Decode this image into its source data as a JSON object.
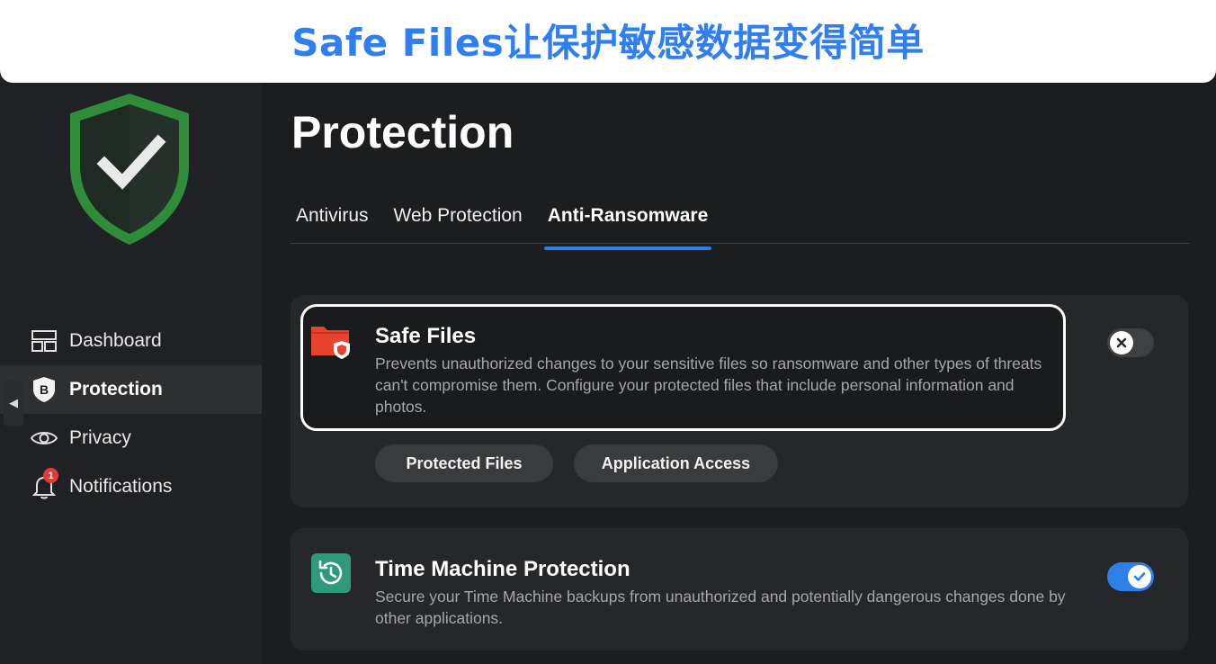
{
  "banner": {
    "text": "Safe Files让保护敏感数据变得简单"
  },
  "sidebar": {
    "logo_icon": "shield-check-icon",
    "items": [
      {
        "label": "Dashboard",
        "icon": "dashboard-icon"
      },
      {
        "label": "Protection",
        "icon": "bitdefender-b-icon",
        "active": true
      },
      {
        "label": "Privacy",
        "icon": "eye-icon"
      },
      {
        "label": "Notifications",
        "icon": "bell-icon",
        "badge": "1"
      }
    ]
  },
  "main": {
    "title": "Protection",
    "tabs": [
      {
        "label": "Antivirus"
      },
      {
        "label": "Web Protection"
      },
      {
        "label": "Anti-Ransomware",
        "active": true
      }
    ],
    "features": [
      {
        "title": "Safe Files",
        "icon": "folder-shield-icon",
        "description": "Prevents unauthorized changes to your sensitive files so ransomware and other types of threats can't compromise them. Configure your protected files that include personal information and photos.",
        "enabled": false,
        "buttons": [
          "Protected Files",
          "Application Access"
        ]
      },
      {
        "title": "Time Machine Protection",
        "icon": "time-machine-icon",
        "description": "Secure your Time Machine backups from unauthorized and potentially dangerous changes done by other applications.",
        "enabled": true
      }
    ]
  },
  "colors": {
    "accent": "#2e7fe8",
    "banner_text": "#2f7ff0",
    "shield_green": "#3fae49",
    "safe_files_red": "#e8432e",
    "time_machine_teal": "#2f9a7a"
  }
}
